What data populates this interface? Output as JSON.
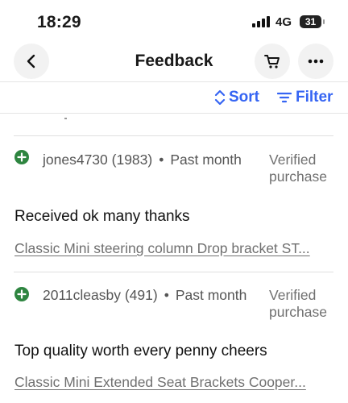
{
  "status_bar": {
    "time": "18:29",
    "network": "4G",
    "battery": "31"
  },
  "header": {
    "title": "Feedback"
  },
  "icons": {
    "back": "chevron-left-icon",
    "cart": "cart-icon",
    "more": "more-horizontal-icon",
    "sort": "sort-arrows-icon",
    "filter": "filter-lines-icon",
    "positive": "positive-rating-icon"
  },
  "toolbar": {
    "sort_label": "Sort",
    "filter_label": "Filter"
  },
  "colors": {
    "accent": "#3665f3",
    "positive": "#2e8540"
  },
  "feedback": [
    {
      "user": "jones4730 (1983)",
      "dot": "•",
      "time": "Past month",
      "verified": "Verified purchase",
      "comment": "Received ok many thanks",
      "item": "Classic Mini steering column Drop bracket ST..."
    },
    {
      "user": "2011cleasby (491)",
      "dot": "•",
      "time": "Past month",
      "verified": "Verified purchase",
      "comment": "Top quality worth every penny cheers",
      "item": "Classic Mini Extended Seat Brackets Cooper..."
    }
  ]
}
